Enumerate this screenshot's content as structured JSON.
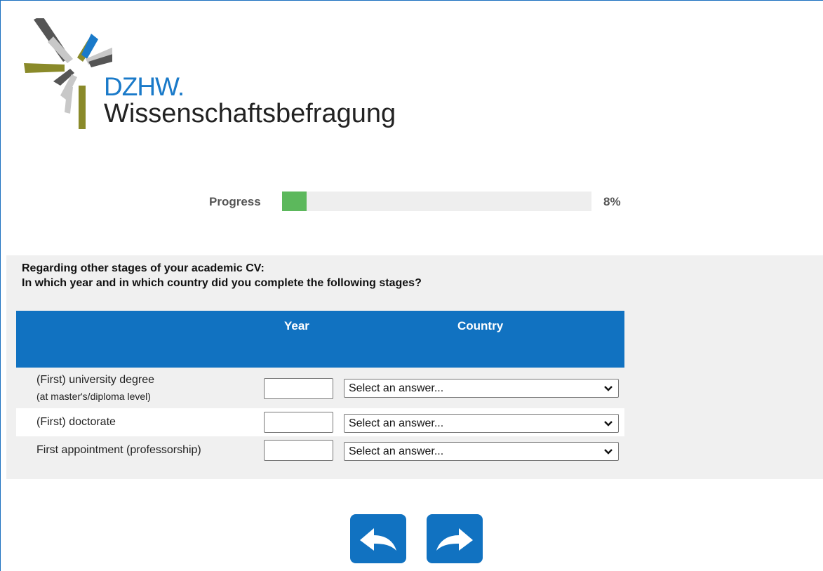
{
  "logo": {
    "brand": "DZHW.",
    "subtitle": "Wissenschaftsbefragung"
  },
  "progress": {
    "label": "Progress",
    "value_text": "8%",
    "fraction": 0.08,
    "fill_color": "#5cb85c"
  },
  "question": {
    "line1": "Regarding other stages of your academic CV:",
    "line2": "In which year and in which country did you complete the following stages?"
  },
  "matrix": {
    "header_color": "#1172c1",
    "columns": [
      "Year",
      "Country"
    ],
    "rows": [
      {
        "label": "(First) university degree",
        "sublabel": "(at master's/diploma level)",
        "year_value": "",
        "country_value": "Select an answer..."
      },
      {
        "label": "(First) doctorate",
        "sublabel": "",
        "year_value": "",
        "country_value": "Select an answer..."
      },
      {
        "label": "First appointment (professorship)",
        "sublabel": "",
        "year_value": "",
        "country_value": "Select an answer..."
      }
    ]
  },
  "navigation": {
    "back_icon": "back-arrow-icon",
    "next_icon": "forward-arrow-icon",
    "button_color": "#1172c1"
  }
}
